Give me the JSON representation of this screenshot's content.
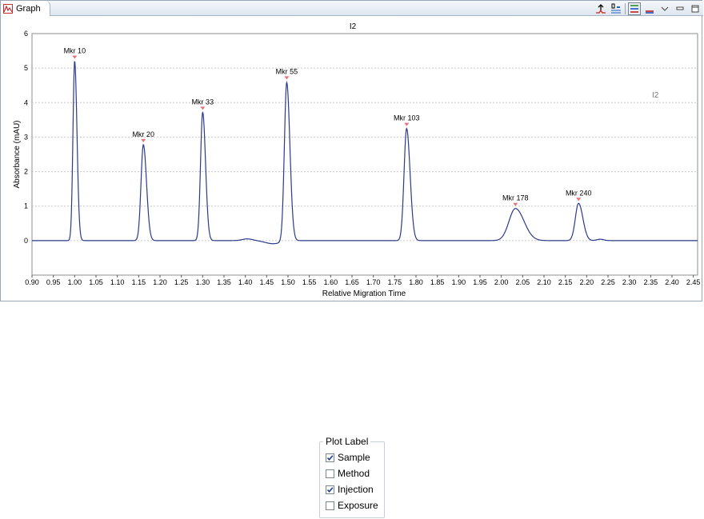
{
  "view": {
    "tab_label": "Graph"
  },
  "chart_data": {
    "type": "line",
    "title": "I2",
    "legend_label": "I2",
    "legend_position": "right",
    "xlabel": "Relative Migration Time",
    "ylabel": "Absorbance (mAU)",
    "xlim": [
      0.9,
      2.46
    ],
    "ylim": [
      -1,
      6
    ],
    "xticks": [
      0.9,
      0.95,
      1.0,
      1.05,
      1.1,
      1.15,
      1.2,
      1.25,
      1.3,
      1.35,
      1.4,
      1.45,
      1.5,
      1.55,
      1.6,
      1.65,
      1.7,
      1.75,
      1.8,
      1.85,
      1.9,
      1.95,
      2.0,
      2.05,
      2.1,
      2.15,
      2.2,
      2.25,
      2.3,
      2.35,
      2.4,
      2.45
    ],
    "yticks": [
      0,
      1,
      2,
      3,
      4,
      5,
      6
    ],
    "grid": true,
    "line_color": "#2b3a8c",
    "marker_color": "#e8707a",
    "peaks": [
      {
        "label": "Mkr 10",
        "x": 1.0,
        "height": 5.2,
        "width": 0.004
      },
      {
        "label": "Mkr 20",
        "x": 1.161,
        "height": 2.78,
        "width": 0.0055
      },
      {
        "label": "Mkr 33",
        "x": 1.3,
        "height": 3.72,
        "width": 0.005
      },
      {
        "label": "Mkr 55",
        "x": 1.497,
        "height": 4.6,
        "width": 0.0055
      },
      {
        "label": "Mkr 103",
        "x": 1.778,
        "height": 3.25,
        "width": 0.006
      },
      {
        "label": "Mkr 178",
        "x": 2.033,
        "height": 0.93,
        "width": 0.015
      },
      {
        "label": "Mkr 240",
        "x": 2.181,
        "height": 1.08,
        "width": 0.0075
      }
    ]
  },
  "plot_label": {
    "title": "Plot Label",
    "options": [
      {
        "label": "Sample",
        "checked": true
      },
      {
        "label": "Method",
        "checked": false
      },
      {
        "label": "Injection",
        "checked": true
      },
      {
        "label": "Exposure",
        "checked": false
      }
    ]
  }
}
